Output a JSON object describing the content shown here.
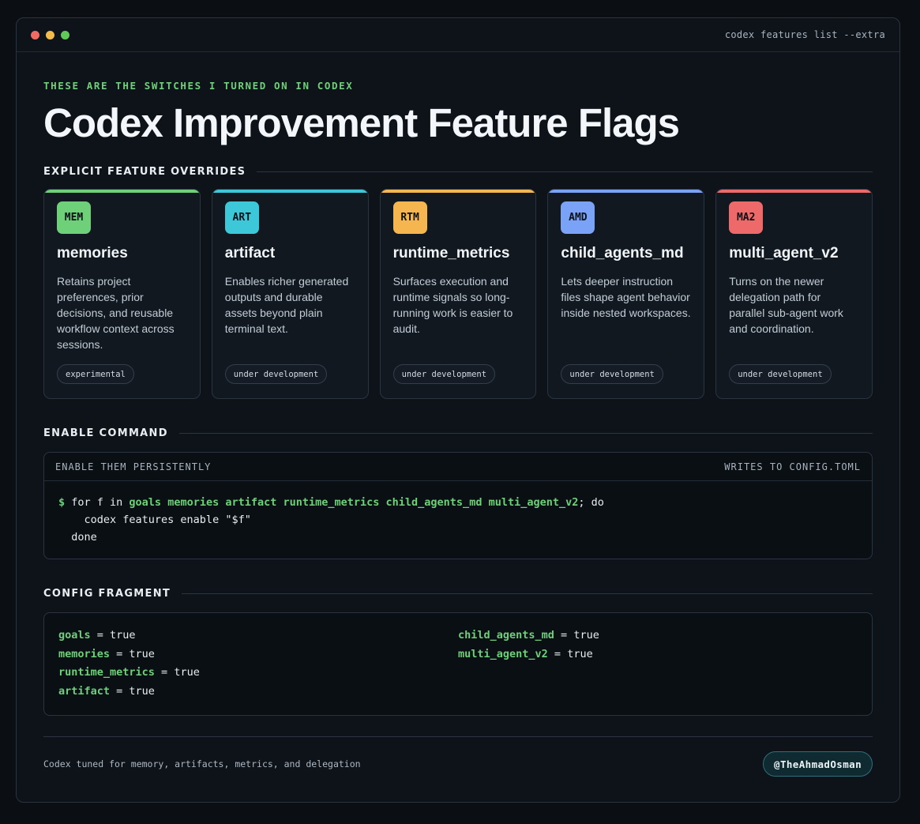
{
  "window": {
    "command": "codex features list --extra"
  },
  "header": {
    "eyebrow": "THESE ARE THE SWITCHES I TURNED ON IN CODEX",
    "title": "Codex Improvement Feature Flags"
  },
  "sections": {
    "overrides": "EXPLICIT FEATURE OVERRIDES",
    "enable": "ENABLE COMMAND",
    "config": "CONFIG FRAGMENT"
  },
  "colors": {
    "green": "#6fd07a",
    "cyan": "#3cc8d8",
    "orange": "#f5b54f",
    "blue": "#7aa2f7",
    "red": "#ee6a6a"
  },
  "cards": [
    {
      "badge": "MEM",
      "title": "memories",
      "desc": "Retains project preferences, prior decisions, and reusable workflow context across sessions.",
      "status": "experimental",
      "color": "#6fd07a"
    },
    {
      "badge": "ART",
      "title": "artifact",
      "desc": "Enables richer generated outputs and durable assets beyond plain terminal text.",
      "status": "under development",
      "color": "#3cc8d8"
    },
    {
      "badge": "RTM",
      "title": "runtime_metrics",
      "desc": "Surfaces execution and runtime signals so long-running work is easier to audit.",
      "status": "under development",
      "color": "#f5b54f"
    },
    {
      "badge": "AMD",
      "title": "child_agents_md",
      "desc": "Lets deeper instruction files shape agent behavior inside nested workspaces.",
      "status": "under development",
      "color": "#7aa2f7"
    },
    {
      "badge": "MA2",
      "title": "multi_agent_v2",
      "desc": "Turns on the newer delegation path for parallel sub-agent work and coordination.",
      "status": "under development",
      "color": "#ee6a6a"
    }
  ],
  "command": {
    "label": "ENABLE THEM PERSISTENTLY",
    "target": "WRITES TO CONFIG.TOML",
    "prompt": "$",
    "for_kw": " for f in ",
    "features": "goals memories artifact runtime_metrics child_agents_md multi_agent_v2",
    "do_kw": "; do",
    "line2": "    codex features enable \"$f\"",
    "line3": "  done"
  },
  "config": {
    "equals": " = ",
    "left": [
      {
        "key": "goals",
        "value": "true"
      },
      {
        "key": "memories",
        "value": "true"
      },
      {
        "key": "runtime_metrics",
        "value": "true"
      },
      {
        "key": "artifact",
        "value": "true"
      }
    ],
    "right": [
      {
        "key": "child_agents_md",
        "value": "true"
      },
      {
        "key": "multi_agent_v2",
        "value": "true"
      }
    ]
  },
  "footer": {
    "text": "Codex tuned for memory, artifacts, metrics, and delegation",
    "handle": "@TheAhmadOsman"
  }
}
